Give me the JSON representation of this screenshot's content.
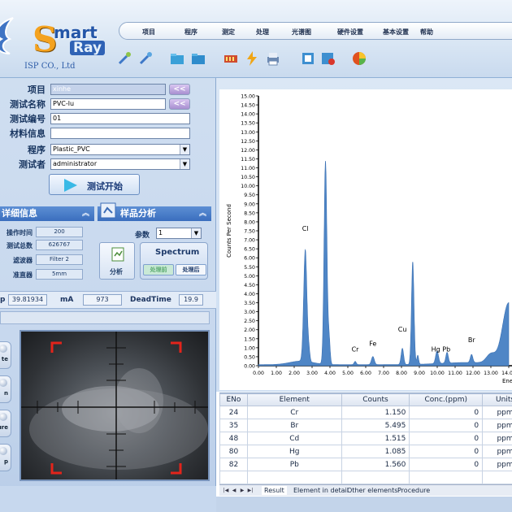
{
  "logo": {
    "s": "S",
    "smart": "mart",
    "ray": "Ray",
    "company": "ISP CO., Ltd"
  },
  "menu": [
    "项目",
    "程序",
    "测定",
    "处理",
    "光谱图",
    "硬件设置",
    "基本设置",
    "帮助"
  ],
  "toolbar": {
    "icons": [
      "tools-icon",
      "tools-alt-icon",
      "folder-open-icon",
      "folder-icon",
      "battery-icon",
      "lightning-icon",
      "printer-icon",
      "image-icon",
      "image-delete-icon",
      "pie-icon"
    ]
  },
  "form": {
    "project": {
      "label": "项目",
      "value": "xinhe",
      "btn": "<<"
    },
    "test_name": {
      "label": "测试名称",
      "value": "PVC-lu",
      "btn": "<<"
    },
    "test_no": {
      "label": "测试编号",
      "value": "01"
    },
    "material": {
      "label": "材料信息",
      "value": ""
    },
    "program": {
      "label": "程序",
      "value": "Plastic_PVC"
    },
    "tester": {
      "label": "测试者",
      "value": "administrator"
    },
    "start_label": "测试开始"
  },
  "details": {
    "title": "详细信息",
    "rows": [
      {
        "label": "操作时间",
        "value": "200"
      },
      {
        "label": "测试总数",
        "value": "626767"
      },
      {
        "label": "滤波器",
        "value": "Filter 2"
      },
      {
        "label": "准直器",
        "value": "5mm"
      }
    ]
  },
  "sample": {
    "title": "样品分析",
    "param_label": "参数",
    "param_value": "1",
    "analyze_label": "分析",
    "spectrum_label": "Spectrum",
    "before_label": "处理前",
    "after_label": "处理后"
  },
  "status": {
    "kv_value": "39.81934",
    "ma_label": "mA",
    "ma_value": "973",
    "deadtime_label": "DeadTime",
    "deadtime_value": "19.9"
  },
  "side_buttons": [
    "te",
    "n",
    "ure",
    "p"
  ],
  "chart_data": {
    "type": "line",
    "ylabel": "Counts Per Second",
    "xlabel": "Ene",
    "xlim": [
      0,
      14.0
    ],
    "ylim": [
      0,
      15.0
    ],
    "x_ticks": [
      "0.00",
      "1.00",
      "2.00",
      "3.00",
      "4.00",
      "5.00",
      "6.00",
      "7.00",
      "8.00",
      "9.00",
      "10.00",
      "11.00",
      "12.00",
      "13.00",
      "14.00"
    ],
    "y_ticks": [
      "0.00",
      "0.50",
      "1.00",
      "1.50",
      "2.00",
      "2.50",
      "3.00",
      "3.50",
      "4.00",
      "4.50",
      "5.00",
      "5.50",
      "6.00",
      "6.50",
      "7.00",
      "7.50",
      "8.00",
      "8.50",
      "9.00",
      "9.50",
      "10.00",
      "10.50",
      "11.00",
      "11.50",
      "12.00",
      "12.50",
      "13.00",
      "13.50",
      "14.00",
      "14.50",
      "15.00"
    ],
    "peaks": [
      {
        "center": 2.62,
        "height": 6.2,
        "width": 0.09
      },
      {
        "center": 2.82,
        "height": 0.6,
        "width": 0.06
      },
      {
        "center": 3.75,
        "height": 11.3,
        "width": 0.08
      },
      {
        "center": 3.95,
        "height": 1.4,
        "width": 0.06
      },
      {
        "center": 5.41,
        "height": 0.18,
        "width": 0.06
      },
      {
        "center": 6.4,
        "height": 0.45,
        "width": 0.08
      },
      {
        "center": 8.05,
        "height": 0.9,
        "width": 0.07
      },
      {
        "center": 8.63,
        "height": 5.7,
        "width": 0.07
      },
      {
        "center": 8.91,
        "height": 0.5,
        "width": 0.05
      },
      {
        "center": 9.99,
        "height": 0.7,
        "width": 0.08
      },
      {
        "center": 10.55,
        "height": 0.6,
        "width": 0.07
      },
      {
        "center": 11.92,
        "height": 0.45,
        "width": 0.07
      },
      {
        "center": 13.0,
        "height": 0.5,
        "width": 0.25
      },
      {
        "center": 14.0,
        "height": 3.4,
        "width": 0.35
      }
    ],
    "annotations": [
      {
        "text": "Cl",
        "x": 2.62,
        "y": 7.5
      },
      {
        "text": "Cr",
        "x": 5.41,
        "y": 0.8
      },
      {
        "text": "Fe",
        "x": 6.4,
        "y": 1.1
      },
      {
        "text": "Cu",
        "x": 8.05,
        "y": 1.9
      },
      {
        "text": "Hg Pb",
        "x": 10.2,
        "y": 0.8
      },
      {
        "text": "Br",
        "x": 11.92,
        "y": 1.3
      }
    ]
  },
  "table": {
    "columns": [
      "ENo",
      "Element",
      "Counts",
      "Conc.(ppm)",
      "Units"
    ],
    "rows": [
      [
        "24",
        "Cr",
        "1.150",
        "0",
        "ppm"
      ],
      [
        "35",
        "Br",
        "5.495",
        "0",
        "ppm"
      ],
      [
        "48",
        "Cd",
        "1.515",
        "0",
        "ppm"
      ],
      [
        "80",
        "Hg",
        "1.085",
        "0",
        "ppm"
      ],
      [
        "82",
        "Pb",
        "1.560",
        "0",
        "ppm"
      ]
    ]
  },
  "tabs": [
    "Result",
    "Element in detail",
    "Other elements",
    "Procedure"
  ]
}
